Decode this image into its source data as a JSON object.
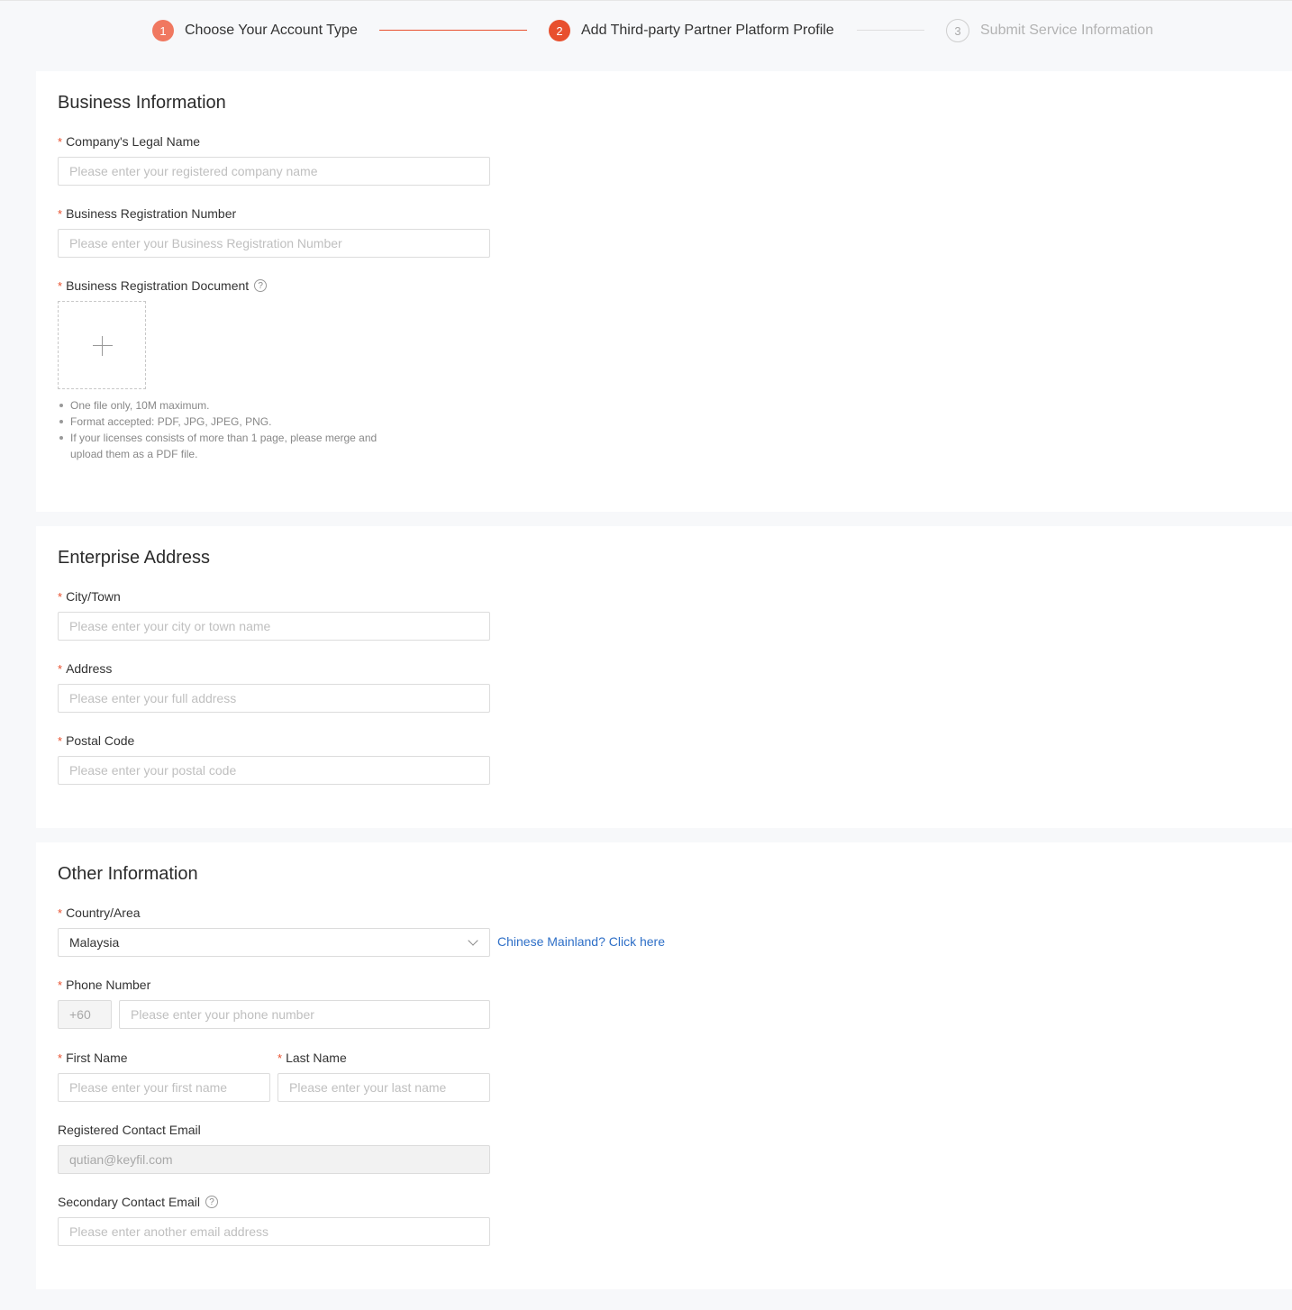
{
  "stepper": {
    "steps": [
      {
        "number": "1",
        "label": "Choose Your Account Type"
      },
      {
        "number": "2",
        "label": "Add Third-party Partner Platform Profile"
      },
      {
        "number": "3",
        "label": "Submit Service Information"
      }
    ],
    "colors": {
      "done": "#f07860",
      "active": "#e8502e",
      "line_done": "#e8502e"
    }
  },
  "required_mark": "*",
  "business": {
    "title": "Business Information",
    "legal_name_label": "Company's Legal Name",
    "legal_name_placeholder": "Please enter your registered company name",
    "reg_number_label": "Business Registration Number",
    "reg_number_placeholder": "Please enter your Business Registration Number",
    "reg_doc_label": "Business Registration Document",
    "help_glyph": "?",
    "notes": [
      "One file only, 10M maximum.",
      "Format accepted: PDF, JPG, JPEG, PNG.",
      "If your licenses consists of more than 1 page, please merge and upload them as a PDF file."
    ]
  },
  "address": {
    "title": "Enterprise Address",
    "city_label": "City/Town",
    "city_placeholder": "Please enter your city or town name",
    "address_label": "Address",
    "address_placeholder": "Please enter your full address",
    "postal_label": "Postal Code",
    "postal_placeholder": "Please enter your postal code"
  },
  "other": {
    "title": "Other Information",
    "country_label": "Country/Area",
    "country_value": "Malaysia",
    "mainland_link": "Chinese Mainland? Click here",
    "phone_label": "Phone Number",
    "phone_prefix": "+60",
    "phone_placeholder": "Please enter your phone number",
    "first_name_label": "First Name",
    "first_name_placeholder": "Please enter your first name",
    "last_name_label": "Last Name",
    "last_name_placeholder": "Please enter your last name",
    "registered_email_label": "Registered Contact Email",
    "registered_email_value": "qutian@keyfil.com",
    "secondary_email_label": "Secondary Contact Email",
    "secondary_email_placeholder": "Please enter another email address",
    "link_color": "#2e6fc7"
  }
}
